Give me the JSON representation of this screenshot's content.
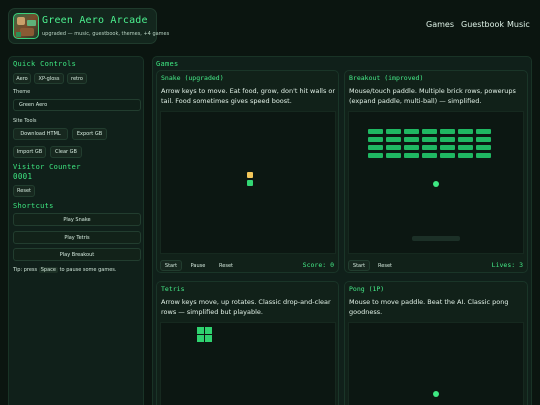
{
  "brand": {
    "title": "Green Aero Arcade",
    "subtitle": "upgraded — music, guestbook, themes, +4 games"
  },
  "nav": [
    "Games",
    "Guestbook",
    "Music"
  ],
  "sidebar": {
    "quick_controls_title": "Quick Controls",
    "themes": [
      "Aero",
      "XP-gloss",
      "retro"
    ],
    "theme_label": "Theme",
    "theme_selected": "Green Aero",
    "site_tools_label": "Site Tools",
    "tools": [
      "Download HTML",
      "Export GB",
      "Import GB",
      "Clear GB"
    ],
    "visitor_counter_title": "Visitor Counter",
    "visitor_count": "0001",
    "reset_label": "Reset",
    "shortcuts_title": "Shortcuts",
    "shortcuts": [
      "Play Snake",
      "Play Tetris",
      "Play Breakout"
    ],
    "tip_prefix": "Tip: press",
    "tip_key": "Space",
    "tip_suffix": "to pause some games."
  },
  "games": {
    "title": "Games",
    "snake": {
      "title": "Snake (upgraded)",
      "desc": "Arrow keys to move. Eat food, grow, don't hit walls or tail. Food sometimes gives speed boost.",
      "buttons": [
        "Start",
        "Pause",
        "Reset"
      ],
      "score_label": "Score:",
      "score_value": "0"
    },
    "breakout": {
      "title": "Breakout (improved)",
      "desc": "Mouse/touch paddle. Multiple brick rows, powerups (expand paddle, multi-ball) — simplified.",
      "buttons": [
        "Start",
        "Reset"
      ],
      "lives_label": "Lives:",
      "lives_value": "3"
    },
    "tetris": {
      "title": "Tetris",
      "desc": "Arrow keys move, up rotates. Classic drop-and-clear rows — simplified but playable."
    },
    "pong": {
      "title": "Pong (1P)",
      "desc": "Mouse to move paddle. Beat the AI. Classic pong goodness."
    }
  },
  "colors": {
    "accent": "#3ee882",
    "background": "#0b1510",
    "panel": "#10201a",
    "food": "#f3c65a"
  }
}
